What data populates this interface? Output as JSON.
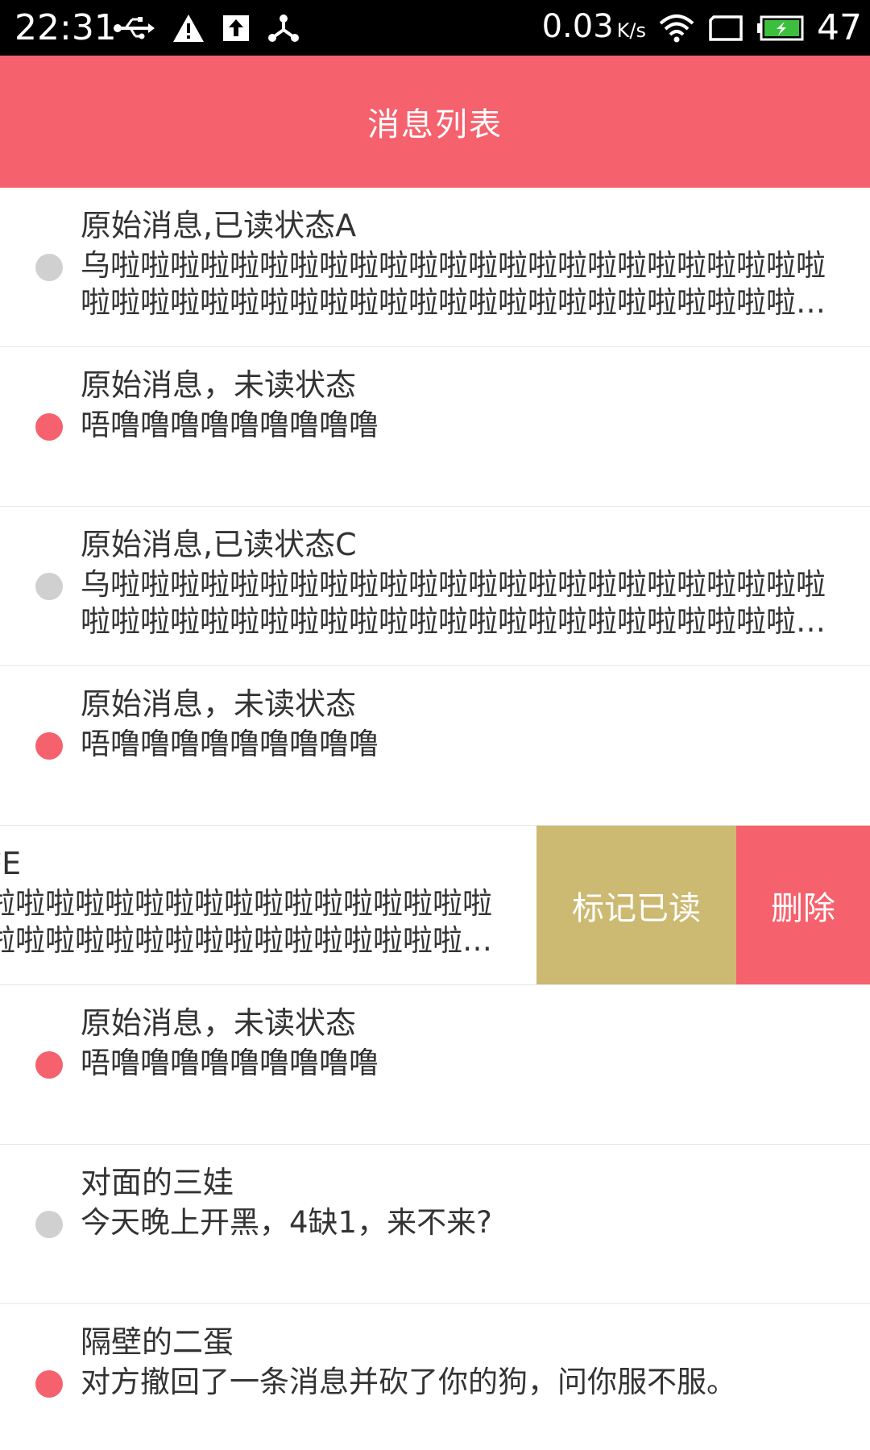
{
  "status_bar": {
    "time": "22:31",
    "net_speed": "0.03",
    "net_speed_unit": "K/s",
    "battery_level": "47"
  },
  "header": {
    "title": "消息列表"
  },
  "colors": {
    "accent": "#f5616d",
    "mark_read": "#ccb972",
    "read_dot": "#d0d0d0"
  },
  "messages": [
    {
      "title": "原始消息,已读状态A",
      "body": "乌啦啦啦啦啦啦啦啦啦啦啦啦啦啦啦啦啦啦啦啦啦啦啦啦啦啦啦啦啦啦啦啦啦啦啦啦啦啦啦啦啦啦啦啦啦啦啦啦啦啦啦..",
      "read": true
    },
    {
      "title": "原始消息，未读状态",
      "body": "唔噜噜噜噜噜噜噜噜噜",
      "read": false
    },
    {
      "title": "原始消息,已读状态C",
      "body": "乌啦啦啦啦啦啦啦啦啦啦啦啦啦啦啦啦啦啦啦啦啦啦啦啦啦啦啦啦啦啦啦啦啦啦啦啦啦啦啦啦啦啦啦啦啦啦啦啦啦啦啦..",
      "read": true
    },
    {
      "title": "原始消息，未读状态",
      "body": "唔噜噜噜噜噜噜噜噜噜",
      "read": false
    },
    {
      "title": "原始消息,已读状态E",
      "body": "乌啦啦啦啦啦啦啦啦啦啦啦啦啦啦啦啦啦啦啦啦啦啦啦啦啦啦啦啦啦啦啦啦啦啦啦啦啦啦啦啦啦啦啦啦啦啦啦啦啦啦啦..",
      "read": true,
      "actions": {
        "mark_read": "标记已读",
        "delete": "删除"
      }
    },
    {
      "title": "原始消息，未读状态",
      "body": "唔噜噜噜噜噜噜噜噜噜",
      "read": false
    },
    {
      "title": "对面的三娃",
      "body": "今天晚上开黑，4缺1，来不来?",
      "read": true
    },
    {
      "title": "隔壁的二蛋",
      "body": "对方撤回了一条消息并砍了你的狗，问你服不服。",
      "read": false
    }
  ]
}
